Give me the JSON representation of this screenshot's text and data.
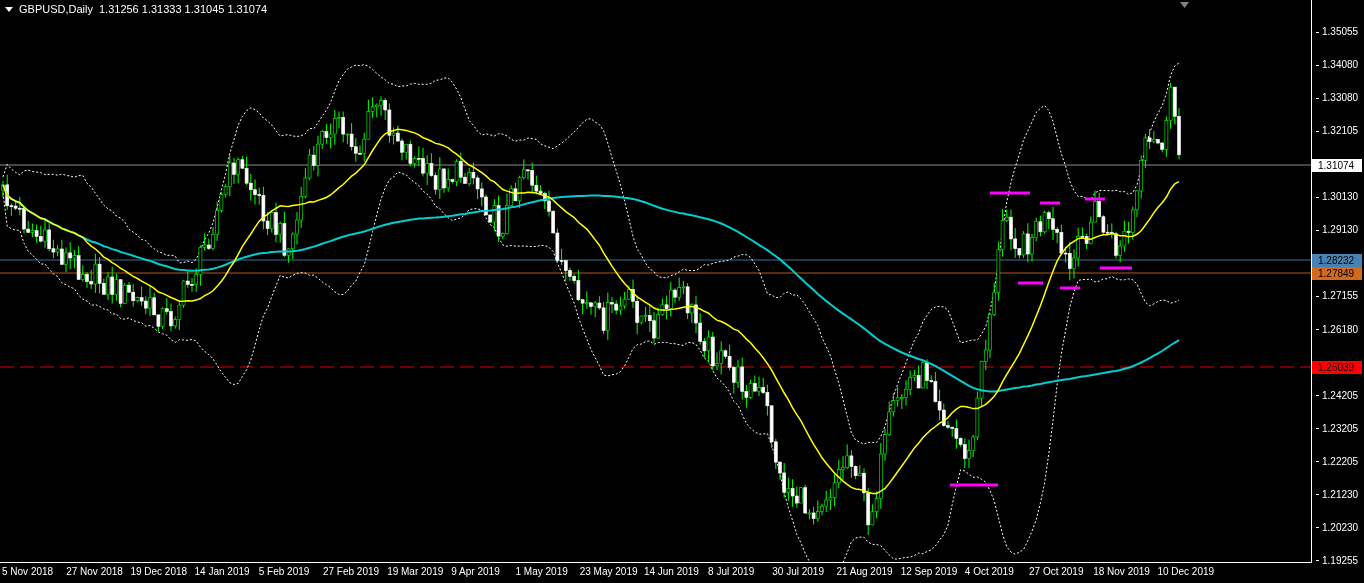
{
  "chart": {
    "symbol_timeframe": "GBPUSD,Daily",
    "ohlc": "1.31256 1.31333 1.31045 1.31074"
  },
  "price_axis": {
    "labels": [
      "1.35055",
      "1.34080",
      "1.33080",
      "1.32105",
      "1.30130",
      "1.29130",
      "1.27155",
      "1.26180",
      "1.24205",
      "1.23205",
      "1.22205",
      "1.21230",
      "1.20230",
      "1.19255"
    ]
  },
  "price_tags": [
    {
      "label": "1.31074",
      "color": "#ffffff"
    },
    {
      "label": "1.28232",
      "color": "#4682b4"
    },
    {
      "label": "1.27849",
      "color": "#d2691e"
    },
    {
      "label": "1.25039",
      "color": "#ff0000"
    }
  ],
  "time_axis": {
    "labels": [
      "5 Nov 2018",
      "27 Nov 2018",
      "19 Dec 2018",
      "14 Jan 2019",
      "5 Feb 2019",
      "27 Feb 2019",
      "19 Mar 2019",
      "9 Apr 2019",
      "1 May 2019",
      "23 May 2019",
      "14 Jun 2019",
      "8 Jul 2019",
      "30 Jul 2019",
      "21 Aug 2019",
      "12 Sep 2019",
      "4 Oct 2019",
      "27 Oct 2019",
      "18 Nov 2019",
      "10 Dec 2019"
    ]
  }
}
